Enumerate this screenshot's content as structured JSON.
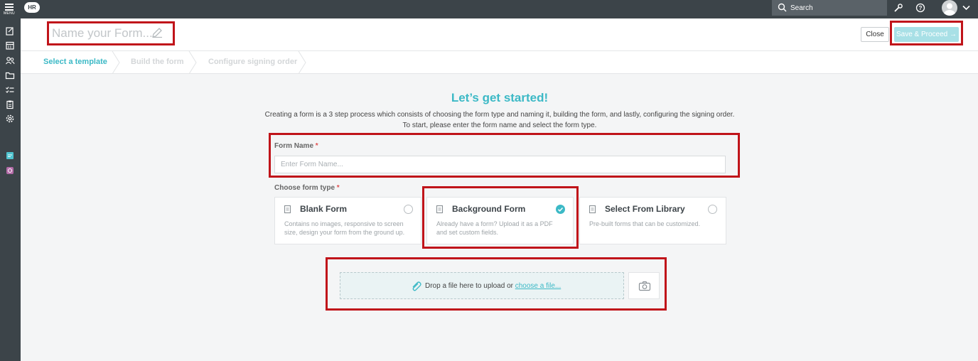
{
  "topbar": {
    "menu_label": "MENU",
    "app_badge": "HR",
    "search_placeholder": "Search"
  },
  "header": {
    "form_title_placeholder": "Name your Form...",
    "close_label": "Close",
    "save_label": "Save & Proceed →"
  },
  "steps": [
    {
      "label": "Select a template",
      "active": true
    },
    {
      "label": "Build the form",
      "active": false
    },
    {
      "label": "Configure signing order",
      "active": false
    }
  ],
  "main": {
    "title": "Let’s get started!",
    "description_line1": "Creating a form is a 3 step process which consists of choosing the form type and naming it, building the form, and lastly, configuring the signing order.",
    "description_line2": "To start, please enter the form name and select the form type.",
    "form_name_label": "Form Name",
    "form_name_placeholder": "Enter Form Name...",
    "form_type_label": "Choose form type",
    "required_mark": "*"
  },
  "form_types": [
    {
      "title": "Blank Form",
      "description": "Contains no images, responsive to screen size, design your form from the ground up.",
      "selected": false
    },
    {
      "title": "Background Form",
      "description": "Already have a form? Upload it as a PDF and set custom fields.",
      "selected": true
    },
    {
      "title": "Select From Library",
      "description": "Pre-built forms that can be customized.",
      "selected": false
    }
  ],
  "upload": {
    "text": "Drop a file here to upload or ",
    "link": "choose a file..."
  },
  "colors": {
    "accent": "#3cb9c6",
    "topbar": "#3c4449",
    "highlight": "#c0141a"
  }
}
